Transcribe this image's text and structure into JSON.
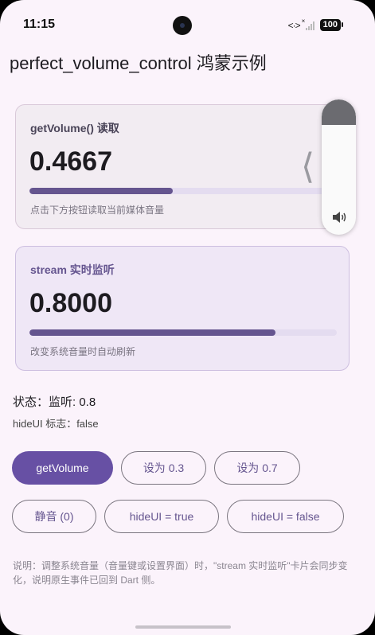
{
  "status_bar": {
    "time": "11:15",
    "battery": "100"
  },
  "app": {
    "title": "perfect_volume_control 鸿蒙示例"
  },
  "get_volume_card": {
    "label": "getVolume() 读取",
    "value": "0.4667",
    "level": 0.4667,
    "hint": "点击下方按钮读取当前媒体音量"
  },
  "stream_card": {
    "label": "stream 实时监听",
    "value": "0.8000",
    "level": 0.8,
    "hint": "改变系统音量时自动刷新"
  },
  "system_volume_panel": {
    "level": 0.19
  },
  "status": {
    "text": "状态：监听: 0.8",
    "hideui": "hideUI 标志：false"
  },
  "buttons": {
    "get_volume": "getVolume",
    "set_03": "设为 0.3",
    "set_07": "设为 0.7",
    "mute": "静音 (0)",
    "hideui_true": "hideUI = true",
    "hideui_false": "hideUI = false"
  },
  "note": "说明：调整系统音量（音量键或设置界面）时，\"stream 实时监听\"卡片会同步变化，说明原生事件已回到 Dart 侧。",
  "colors": {
    "accent": "#6750A4",
    "progress": "#65558F",
    "background": "#FBF3FB"
  }
}
